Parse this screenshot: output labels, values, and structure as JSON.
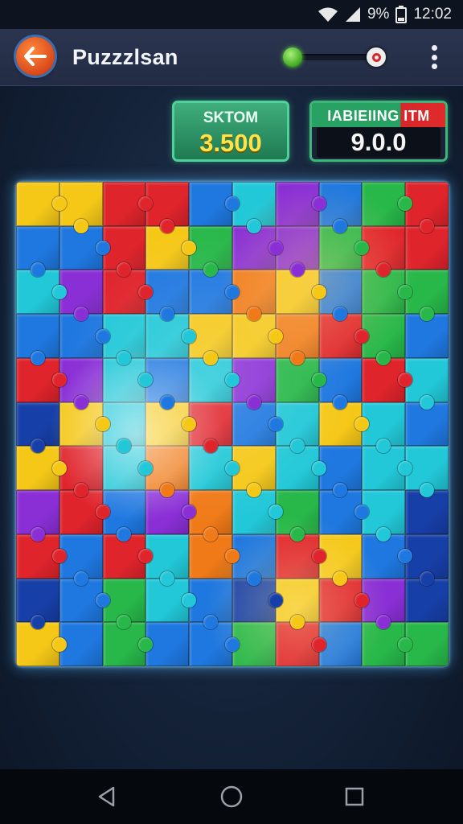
{
  "status_bar": {
    "battery": "9%",
    "time": "12:02"
  },
  "app_bar": {
    "title": "Puzzzlsan"
  },
  "score_left": {
    "label": "SKTOM",
    "value": "3.500"
  },
  "score_right": {
    "label": "IABIEIING ITM",
    "value": "9.0.0"
  },
  "puzzle": {
    "columns": 10,
    "rows": 11,
    "colors": {
      "r": "#e0242c",
      "o": "#f07a18",
      "y": "#f5c818",
      "g": "#28b84a",
      "l": "#22c8d8",
      "b": "#1f78e0",
      "n": "#173fa8",
      "p": "#8a2fd6",
      "m": "#d038b8"
    },
    "grid": [
      "yyrrblpbgr",
      "bbrygppgrr",
      "lprbboybgg",
      "bbllyyorgb",
      "rplblpgbrl",
      "nylyrblylb",
      "yrlolylbll",
      "prbpolgbln",
      "rbrlobrybn",
      "nbglbnyrpn",
      "ybgbbgrbgg"
    ]
  }
}
